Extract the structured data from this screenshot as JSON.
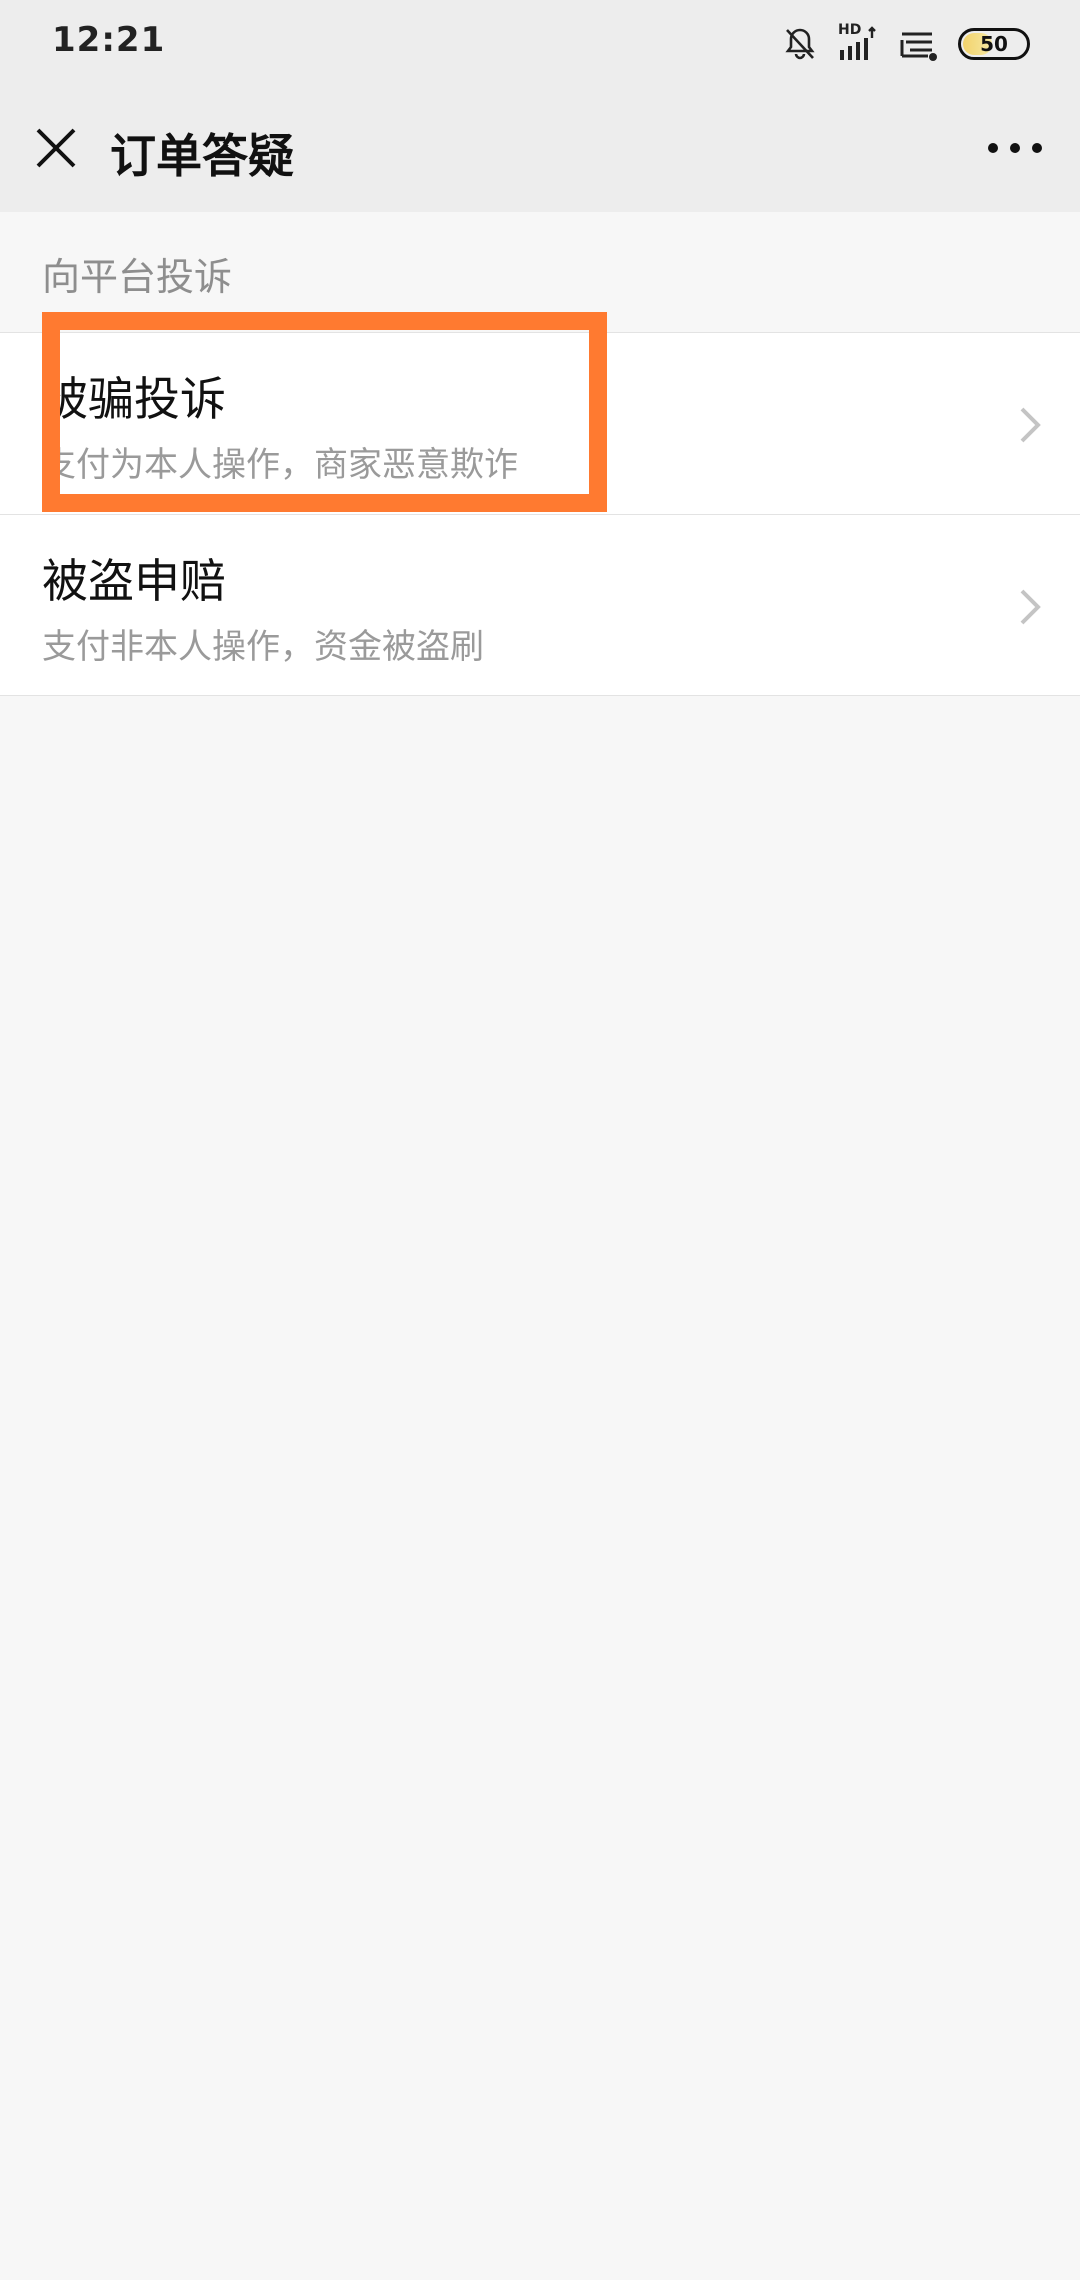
{
  "status_bar": {
    "time": "12:21",
    "network_label": "HD",
    "battery_level": "50",
    "icons": [
      "bell-muted-icon",
      "signal-hd-icon",
      "wifi-icon",
      "battery-icon"
    ]
  },
  "header": {
    "title": "订单答疑",
    "close_icon": "close-icon",
    "more_icon": "more-dots-icon"
  },
  "section": {
    "title": "向平台投诉"
  },
  "list": {
    "items": [
      {
        "title": "被骗投诉",
        "subtitle": "支付为本人操作，商家恶意欺诈"
      },
      {
        "title": "被盗申赔",
        "subtitle": "支付非本人操作，资金被盗刷"
      }
    ]
  },
  "colors": {
    "highlight": "#ff7a30",
    "background": "#f7f7f7",
    "header_bg": "#ededed"
  }
}
